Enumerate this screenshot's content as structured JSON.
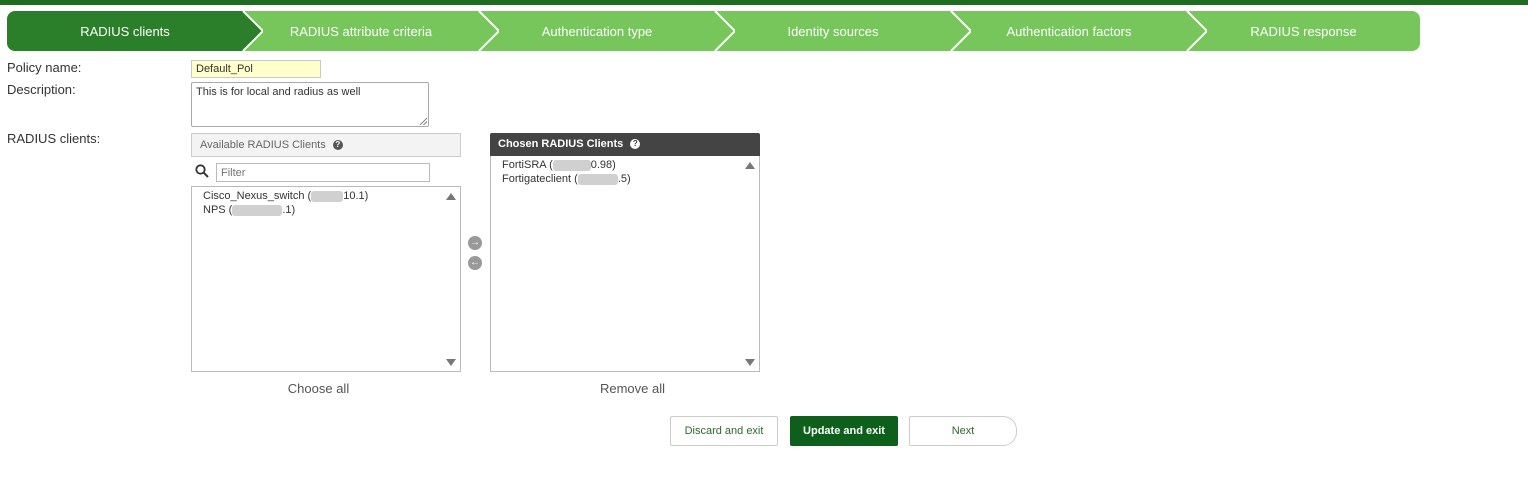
{
  "colors": {
    "top_bar": "#1f6b1f",
    "step_active": "#2c7f2a",
    "step_inactive": "#76c65b",
    "primary_button": "#0e5f1c"
  },
  "wizard": {
    "steps": [
      {
        "label": "RADIUS clients",
        "active": true
      },
      {
        "label": "RADIUS attribute criteria",
        "active": false
      },
      {
        "label": "Authentication type",
        "active": false
      },
      {
        "label": "Identity sources",
        "active": false
      },
      {
        "label": "Authentication factors",
        "active": false
      },
      {
        "label": "RADIUS response",
        "active": false
      }
    ]
  },
  "form": {
    "policy_name_label": "Policy name:",
    "policy_name_value": "Default_Pol",
    "description_label": "Description:",
    "description_value": "This is for local and radius as well",
    "radius_clients_label": "RADIUS clients:"
  },
  "available": {
    "title": "Available RADIUS Clients",
    "help_icon": "help-icon",
    "filter_placeholder": "Filter",
    "filter_icon": "search-icon",
    "items": [
      {
        "prefix": "Cisco_Nexus_switch (",
        "suffix": "10.1)"
      },
      {
        "prefix": "NPS (",
        "suffix": ".1)"
      }
    ],
    "choose_all_label": "Choose all"
  },
  "chosen": {
    "title": "Chosen RADIUS Clients",
    "help_icon": "help-icon",
    "items": [
      {
        "prefix": "FortiSRA (",
        "suffix": "0.98)"
      },
      {
        "prefix": "Fortigateclient (",
        "suffix": ".5)"
      }
    ],
    "remove_all_label": "Remove all"
  },
  "move": {
    "right_icon": "arrow-right-icon",
    "left_icon": "arrow-left-icon",
    "right_glyph": "→",
    "left_glyph": "←"
  },
  "buttons": {
    "discard_label": "Discard and exit",
    "update_label": "Update and exit",
    "next_label": "Next"
  }
}
